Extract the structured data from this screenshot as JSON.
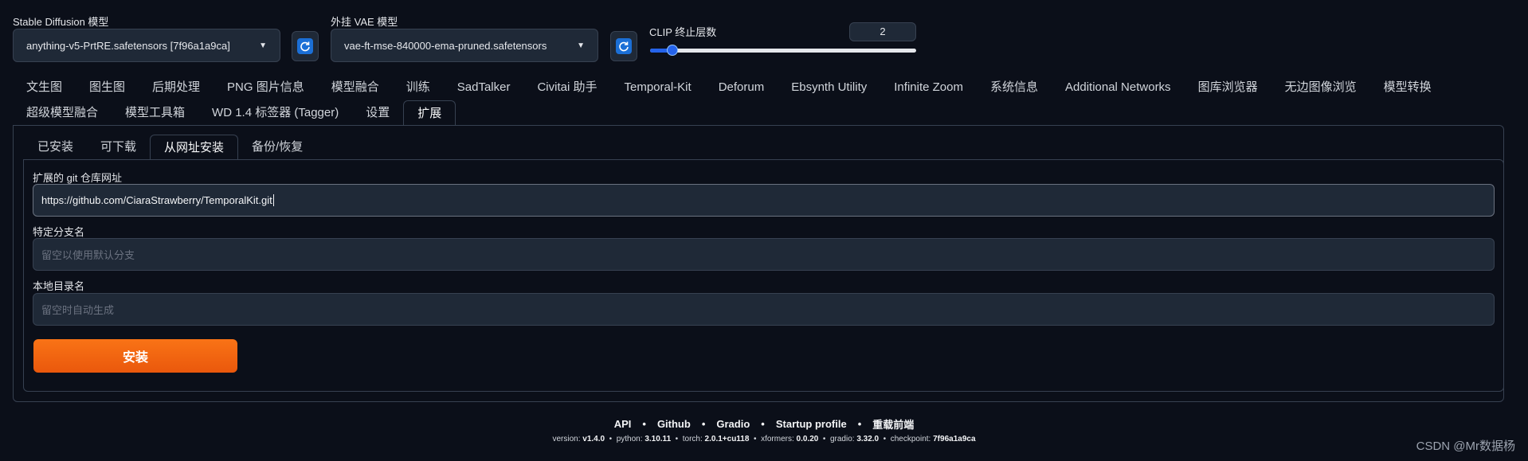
{
  "top": {
    "sd_model_label": "Stable Diffusion 模型",
    "sd_model_value": "anything-v5-PrtRE.safetensors [7f96a1a9ca]",
    "vae_label": "外挂 VAE 模型",
    "vae_value": "vae-ft-mse-840000-ema-pruned.safetensors",
    "clip_label": "CLIP 终止层数",
    "clip_value": "2",
    "clip_fraction": 0.083
  },
  "main_tabs_row1": [
    "文生图",
    "图生图",
    "后期处理",
    "PNG 图片信息",
    "模型融合",
    "训练",
    "SadTalker",
    "Civitai 助手",
    "Temporal-Kit",
    "Deforum",
    "Ebsynth Utility",
    "Infinite Zoom",
    "系统信息",
    "Additional Networks",
    "图库浏览器",
    "无边图像浏览",
    "模型转换"
  ],
  "main_tabs_row2": [
    "超级模型融合",
    "模型工具箱",
    "WD 1.4 标签器 (Tagger)",
    "设置",
    "扩展"
  ],
  "active_main_tab": "扩展",
  "sub_tabs": [
    "已安装",
    "可下载",
    "从网址安装",
    "备份/恢复"
  ],
  "active_sub_tab": "从网址安装",
  "form": {
    "git_label": "扩展的 git 仓库网址",
    "git_value": "https://github.com/CiaraStrawberry/TemporalKit.git",
    "branch_label": "特定分支名",
    "branch_placeholder": "留空以使用默认分支",
    "dir_label": "本地目录名",
    "dir_placeholder": "留空时自动生成",
    "install_button": "安装"
  },
  "footer": {
    "links": [
      "API",
      "Github",
      "Gradio",
      "Startup profile",
      "重载前端"
    ],
    "versions": [
      {
        "k": "version:",
        "v": "v1.4.0"
      },
      {
        "k": "python:",
        "v": "3.10.11"
      },
      {
        "k": "torch:",
        "v": "2.0.1+cu118"
      },
      {
        "k": "xformers:",
        "v": "0.0.20"
      },
      {
        "k": "gradio:",
        "v": "3.32.0"
      },
      {
        "k": "checkpoint:",
        "v": "7f96a1a9ca"
      }
    ]
  },
  "watermark": "CSDN @Mr数据杨",
  "icons": {
    "refresh": "refresh-icon",
    "caret": "chevron-down-icon"
  },
  "colors": {
    "accent": "#f97316",
    "background": "#0b0f19",
    "slider": "#2563eb"
  }
}
